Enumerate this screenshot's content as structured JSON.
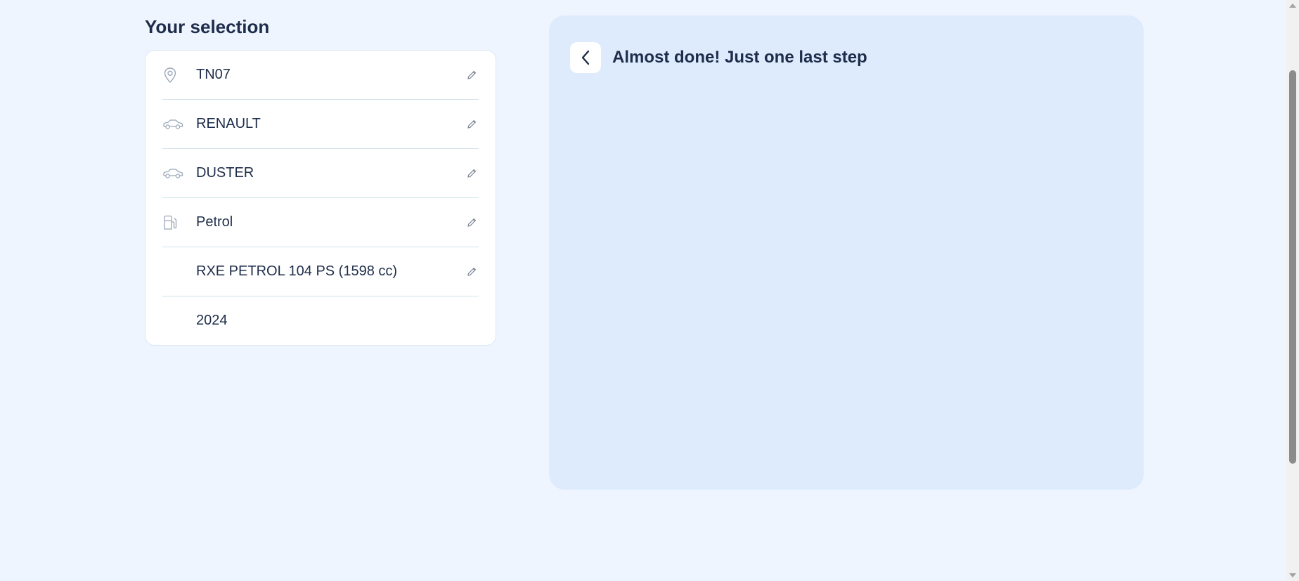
{
  "selection": {
    "title": "Your selection",
    "items": [
      {
        "icon": "location-pin-icon",
        "label": "TN07",
        "editable": true
      },
      {
        "icon": "car-icon",
        "label": "RENAULT",
        "editable": true
      },
      {
        "icon": "car-icon",
        "label": "DUSTER",
        "editable": true
      },
      {
        "icon": "fuel-pump-icon",
        "label": "Petrol",
        "editable": true
      },
      {
        "icon": "",
        "label": "RXE PETROL 104 PS (1598 cc)",
        "editable": true
      },
      {
        "icon": "",
        "label": "2024",
        "editable": false
      }
    ]
  },
  "step": {
    "title": "Almost done! Just one last step"
  },
  "colors": {
    "page_bg": "#eff5fe",
    "panel_bg": "#deebfd",
    "text": "#1e2d4a",
    "icon": "#9aa7b8",
    "divider": "#cfe3ea"
  }
}
